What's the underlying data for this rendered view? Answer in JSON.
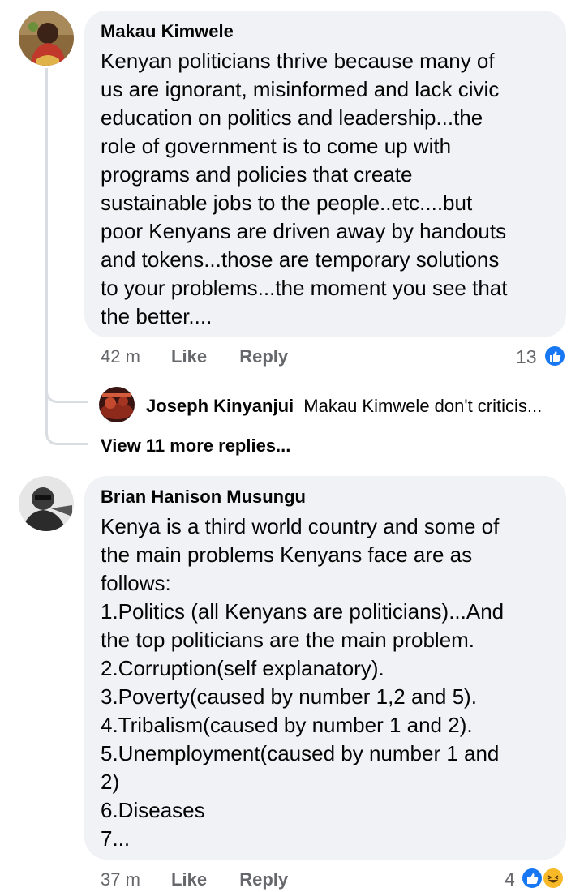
{
  "comment1": {
    "author": "Makau Kimwele",
    "lines": [
      "Kenyan politicians thrive because many of",
      "us are ignorant, misinformed and lack civic",
      "education on politics and leadership...the",
      "role of government is to come up with",
      "programs and policies that create",
      "sustainable jobs to the people..etc....but",
      "poor Kenyans are driven away by handouts",
      "and tokens...those are temporary solutions",
      "to your problems...the moment you see that",
      "the better...."
    ],
    "time": "42 m",
    "like_label": "Like",
    "reply_label": "Reply",
    "reaction_count": "13",
    "reply_preview": {
      "author": "Joseph Kinyanjui",
      "text": "Makau Kimwele don't criticis..."
    },
    "view_more": "View 11 more replies..."
  },
  "comment2": {
    "author": "Brian Hanison Musungu",
    "lines": [
      "Kenya is a third world country and some of",
      "the main problems Kenyans face are as",
      "follows:",
      "1.Politics (all Kenyans are politicians)...And",
      "the top politicians are the main problem.",
      "2.Corruption(self explanatory).",
      "3.Poverty(caused by number 1,2 and 5).",
      "4.Tribalism(caused by number 1 and 2).",
      "5.Unemployment(caused by number 1 and",
      "2)",
      "6.Diseases",
      "7..."
    ],
    "time": "37 m",
    "like_label": "Like",
    "reply_label": "Reply",
    "reaction_count": "4"
  },
  "colors": {
    "bubble": "#f0f2f5",
    "like_blue": "#1877f2",
    "haha_yellow": "#f7b928",
    "meta_gray": "#65676b"
  }
}
